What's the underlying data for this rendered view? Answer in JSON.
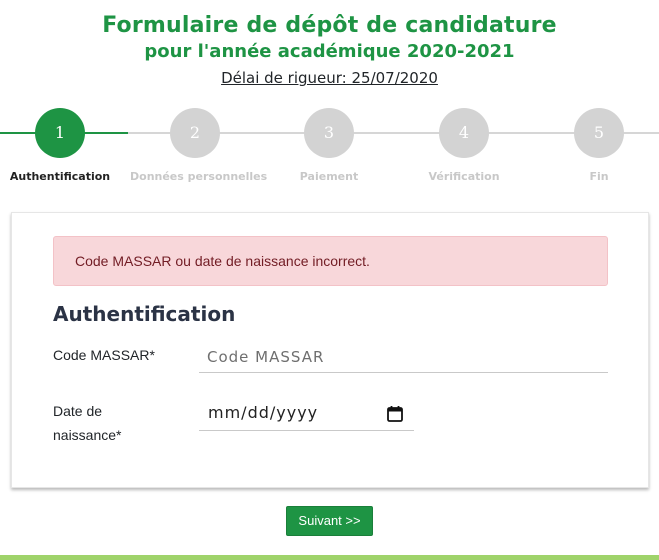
{
  "header": {
    "title": "Formulaire de dépôt de candidature",
    "subtitle": "pour l'année académique 2020-2021",
    "deadline": "Délai de rigueur: 25/07/2020"
  },
  "stepper": {
    "steps": [
      {
        "number": "1",
        "label": "Authentification",
        "active": true
      },
      {
        "number": "2",
        "label": "Données personnelles",
        "active": false
      },
      {
        "number": "3",
        "label": "Paiement",
        "active": false
      },
      {
        "number": "4",
        "label": "Vérification",
        "active": false
      },
      {
        "number": "5",
        "label": "Fin",
        "active": false
      }
    ]
  },
  "alert": {
    "message": "Code MASSAR ou date de naissance incorrect."
  },
  "form": {
    "section_title": "Authentification",
    "massar_label": "Code MASSAR*",
    "massar_placeholder": "Code MASSAR",
    "massar_value": "",
    "dob_label": "Date de naissance*",
    "dob_placeholder": "mm/dd/yyyy",
    "dob_icon": "calendar-icon"
  },
  "actions": {
    "next_label": "Suivant >>"
  },
  "colors": {
    "primary": "#1e9444",
    "inactive_step": "#d3d3d3",
    "alert_bg": "#f8d7da",
    "alert_text": "#721c24",
    "bottom_bar": "#9fd36a"
  }
}
